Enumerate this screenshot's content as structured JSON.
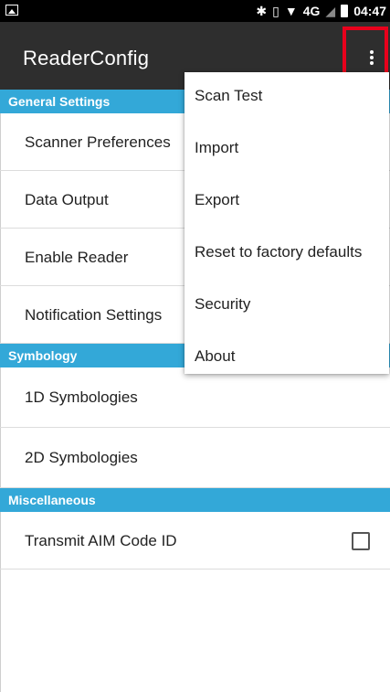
{
  "status_bar": {
    "time": "04:47",
    "network": "4G",
    "icons": [
      "image-icon",
      "bluetooth-icon",
      "vibrate-icon",
      "wifi-icon",
      "signal-icon",
      "battery-icon"
    ]
  },
  "app_bar": {
    "title": "ReaderConfig",
    "overflow_icon": "more-vert-icon"
  },
  "sections": {
    "general": {
      "header": "General Settings",
      "items": [
        "Scanner Preferences",
        "Data Output",
        "Enable Reader",
        "Notification Settings"
      ]
    },
    "symbology": {
      "header": "Symbology",
      "items": [
        "1D Symbologies",
        "2D Symbologies"
      ]
    },
    "misc": {
      "header": "Miscellaneous",
      "items": [
        "Transmit AIM Code ID"
      ],
      "transmit_checked": false
    }
  },
  "overflow_menu": {
    "items": [
      "Scan Test",
      "Import",
      "Export",
      "Reset to factory defaults",
      "Security",
      "About"
    ]
  },
  "colors": {
    "status_bar": "#000000",
    "app_bar": "#2e2e2e",
    "section_header": "#33a8d8",
    "highlight_box": "#e8001c"
  }
}
